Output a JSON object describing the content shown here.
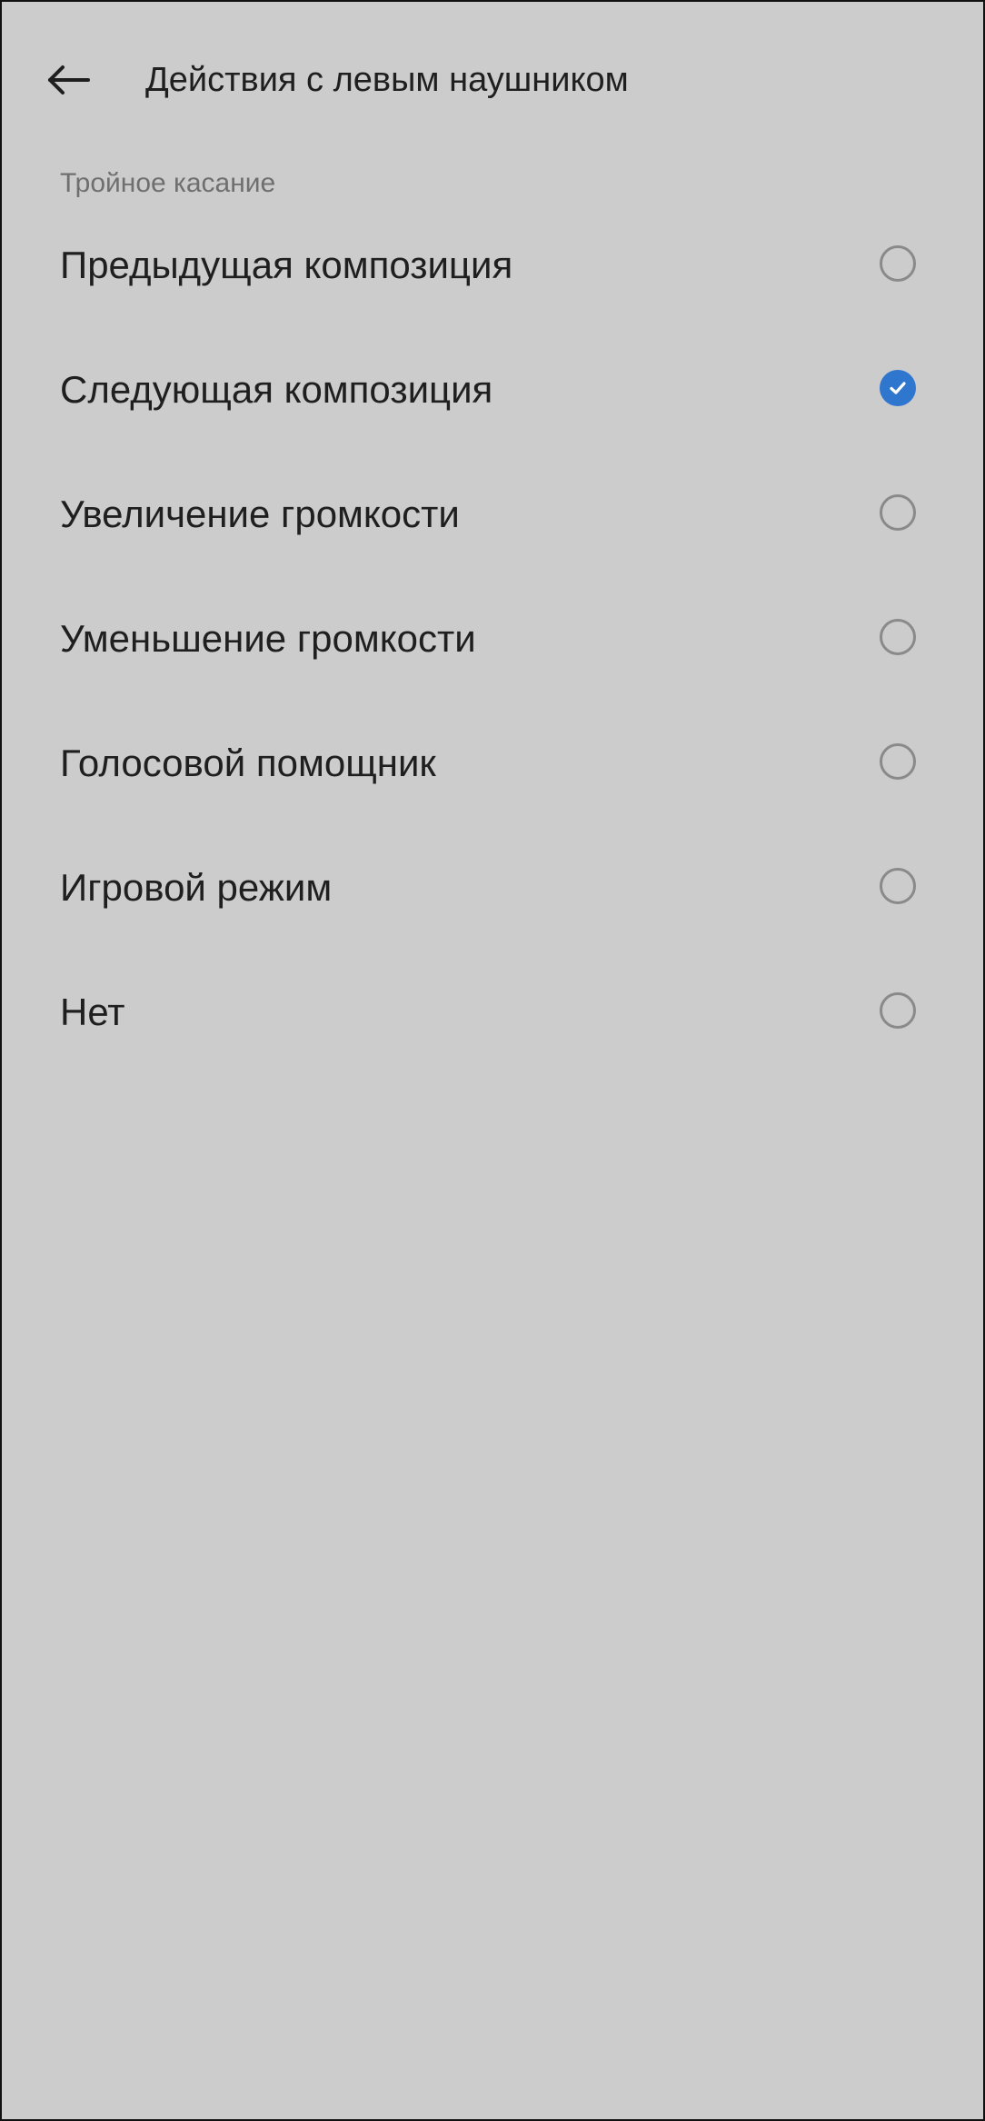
{
  "header": {
    "back_icon": "arrow-left-icon",
    "title": "Действия с левым наушником"
  },
  "section": {
    "title": "Тройное касание"
  },
  "options": [
    {
      "label": "Предыдущая композиция",
      "selected": false
    },
    {
      "label": "Следующая композиция",
      "selected": true
    },
    {
      "label": "Увеличение громкости",
      "selected": false
    },
    {
      "label": "Уменьшение громкости",
      "selected": false
    },
    {
      "label": "Голосовой помощник",
      "selected": false
    },
    {
      "label": "Игровой режим",
      "selected": false
    },
    {
      "label": "Нет",
      "selected": false
    }
  ],
  "colors": {
    "background": "#cccccc",
    "text_primary": "#1f1f1f",
    "text_secondary": "#6f6f6f",
    "accent": "#2f76cf",
    "radio_border": "#8a8a8a"
  },
  "icons": {
    "radio_unchecked": "radio-unchecked-icon",
    "radio_checked": "checkmark-icon"
  }
}
